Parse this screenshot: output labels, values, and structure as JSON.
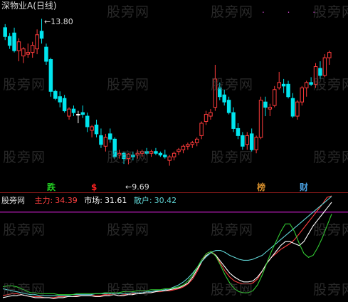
{
  "colors": {
    "background": "#000000",
    "up_candle": "#ff3b3b",
    "down_candle": "#00e5ee",
    "doji": "#ffffff",
    "label_white": "#dddddd",
    "main_force": "#ff4040",
    "market": "#ffffff",
    "retail": "#5fd3d3",
    "purple_line": "#d020d0",
    "separator": "#8b1a1a",
    "green_line": "#33cc33",
    "signal_die": "#22cc22",
    "signal_dollar": "#ff2222",
    "signal_bang": "#d08a2a",
    "signal_cai": "#4aa0e0",
    "watermark": "#4a4a4a"
  },
  "header": {
    "title": "深物业A(日线)",
    "high_label": "13.80",
    "low_label": "9.69"
  },
  "signals": {
    "die": "跌",
    "dollar": "$",
    "bang": "榜",
    "cai": "财"
  },
  "indicator": {
    "name": "股旁网",
    "main_label": "主力:",
    "main_value": "34.39",
    "market_label": "市场:",
    "market_value": "31.61",
    "retail_label": "散户:",
    "retail_value": "30.42"
  },
  "watermark_text": "股旁网",
  "top_marks": ".   .  .",
  "chart_data": [
    {
      "type": "candlestick",
      "title": "深物业A(日线)",
      "annotations": [
        {
          "text": "13.80",
          "value": 13.8
        },
        {
          "text": "9.69",
          "value": 9.69
        }
      ],
      "ylim": [
        9.3,
        14.05
      ],
      "candles": [
        [
          13.55,
          13.65,
          13.2,
          13.3
        ],
        [
          13.3,
          13.4,
          12.95,
          13.05
        ],
        [
          13.4,
          13.55,
          12.85,
          12.9
        ],
        [
          12.9,
          13.25,
          12.6,
          13.15
        ],
        [
          12.75,
          13.0,
          12.55,
          12.95
        ],
        [
          12.8,
          13.1,
          12.7,
          12.85
        ],
        [
          12.85,
          13.15,
          12.7,
          13.05
        ],
        [
          12.95,
          13.5,
          12.8,
          13.35
        ],
        [
          13.45,
          13.8,
          13.1,
          13.25
        ],
        [
          13.0,
          13.1,
          12.5,
          12.6
        ],
        [
          12.65,
          12.7,
          11.6,
          11.75
        ],
        [
          11.75,
          11.8,
          11.5,
          11.55
        ],
        [
          11.6,
          11.75,
          11.3,
          11.45
        ],
        [
          11.55,
          11.65,
          11.15,
          11.2
        ],
        [
          11.05,
          11.3,
          10.95,
          11.25
        ],
        [
          11.25,
          11.35,
          11.05,
          11.15
        ],
        [
          11.1,
          11.2,
          10.85,
          11.1
        ],
        [
          11.15,
          11.35,
          11.0,
          11.1
        ],
        [
          11.05,
          11.15,
          10.6,
          10.75
        ],
        [
          10.65,
          10.8,
          10.45,
          10.75
        ],
        [
          10.8,
          10.95,
          10.45,
          10.55
        ],
        [
          10.5,
          10.7,
          10.15,
          10.25
        ],
        [
          10.2,
          10.55,
          10.05,
          10.45
        ],
        [
          10.55,
          10.7,
          10.3,
          10.4
        ],
        [
          10.4,
          10.45,
          9.85,
          9.9
        ],
        [
          9.95,
          10.1,
          9.85,
          10.0
        ],
        [
          10.0,
          10.05,
          9.7,
          9.85
        ],
        [
          9.85,
          10.0,
          9.69,
          9.98
        ],
        [
          9.95,
          10.05,
          9.8,
          9.9
        ],
        [
          9.95,
          10.1,
          9.85,
          10.0
        ],
        [
          10.0,
          10.1,
          9.9,
          10.05
        ],
        [
          10.05,
          10.15,
          9.95,
          10.0
        ],
        [
          10.0,
          10.1,
          9.9,
          10.05
        ],
        [
          10.05,
          10.15,
          9.95,
          10.0
        ],
        [
          10.0,
          10.05,
          9.9,
          9.95
        ],
        [
          9.95,
          10.1,
          9.85,
          9.9
        ],
        [
          9.8,
          9.95,
          9.65,
          9.9
        ],
        [
          9.9,
          10.05,
          9.8,
          10.0
        ],
        [
          10.05,
          10.15,
          9.95,
          10.1
        ],
        [
          10.1,
          10.25,
          10.0,
          10.2
        ],
        [
          10.2,
          10.3,
          10.1,
          10.25
        ],
        [
          10.25,
          10.35,
          10.15,
          10.3
        ],
        [
          10.3,
          10.45,
          10.2,
          10.4
        ],
        [
          10.5,
          10.9,
          10.4,
          10.85
        ],
        [
          10.9,
          11.2,
          10.8,
          11.1
        ],
        [
          11.05,
          11.25,
          10.95,
          11.15
        ],
        [
          11.3,
          12.5,
          11.2,
          12.1
        ],
        [
          11.85,
          12.0,
          11.5,
          11.6
        ],
        [
          11.65,
          11.8,
          11.35,
          11.45
        ],
        [
          11.5,
          11.6,
          11.1,
          11.15
        ],
        [
          11.15,
          11.3,
          10.6,
          10.7
        ],
        [
          10.7,
          10.85,
          10.4,
          10.5
        ],
        [
          10.5,
          10.6,
          10.1,
          10.2
        ],
        [
          10.25,
          10.6,
          10.1,
          10.5
        ],
        [
          10.55,
          10.7,
          10.05,
          10.1
        ],
        [
          10.1,
          10.5,
          10.0,
          10.45
        ],
        [
          10.45,
          11.6,
          10.4,
          11.5
        ],
        [
          11.45,
          11.6,
          11.05,
          11.3
        ],
        [
          11.25,
          11.4,
          11.05,
          11.3
        ],
        [
          11.35,
          11.9,
          11.3,
          11.8
        ],
        [
          11.85,
          12.3,
          11.8,
          12.0
        ],
        [
          11.95,
          12.1,
          11.7,
          11.9
        ],
        [
          11.95,
          12.05,
          11.55,
          11.6
        ],
        [
          11.55,
          11.7,
          11.0,
          11.05
        ],
        [
          11.05,
          11.5,
          10.95,
          11.45
        ],
        [
          11.45,
          11.9,
          11.35,
          11.85
        ],
        [
          11.85,
          12.05,
          11.6,
          12.0
        ],
        [
          12.0,
          12.15,
          11.9,
          11.95
        ],
        [
          11.95,
          12.55,
          11.85,
          12.45
        ],
        [
          12.4,
          12.6,
          12.1,
          12.2
        ],
        [
          12.2,
          12.8,
          12.15,
          12.7
        ],
        [
          12.7,
          12.9,
          12.5,
          12.85
        ]
      ]
    },
    {
      "type": "line",
      "title": "股旁网",
      "ylim": [
        0,
        100
      ],
      "reference_line": 90,
      "series": [
        {
          "name": "主力",
          "color": "#ff4040",
          "values": [
            5,
            6,
            7,
            7,
            6,
            5,
            4,
            4,
            4,
            3,
            3,
            3,
            4,
            4,
            4,
            4,
            5,
            5,
            5,
            5,
            5,
            5,
            6,
            6,
            6,
            5,
            6,
            6,
            7,
            7,
            8,
            8,
            8,
            9,
            9,
            10,
            10,
            11,
            12,
            14,
            17,
            22,
            30,
            40,
            48,
            50,
            46,
            38,
            30,
            24,
            20,
            18,
            17,
            17,
            18,
            22,
            30,
            38,
            44,
            48,
            52,
            55,
            58,
            62,
            68,
            74,
            80,
            86,
            92,
            98,
            105,
            110
          ]
        },
        {
          "name": "市场",
          "color": "#ffffff",
          "values": [
            3,
            4,
            5,
            5,
            6,
            5,
            4,
            3,
            3,
            3,
            3,
            2,
            3,
            3,
            4,
            4,
            4,
            5,
            5,
            5,
            4,
            4,
            5,
            5,
            6,
            5,
            5,
            6,
            6,
            7,
            7,
            8,
            8,
            9,
            10,
            10,
            11,
            12,
            13,
            15,
            18,
            24,
            32,
            40,
            46,
            49,
            46,
            40,
            34,
            28,
            24,
            21,
            19,
            19,
            20,
            24,
            30,
            38,
            44,
            50,
            56,
            60,
            60,
            58,
            56,
            60,
            68,
            76,
            82,
            88,
            94,
            100
          ]
        },
        {
          "name": "散户",
          "color": "#5fd3d3",
          "values": [
            12,
            11,
            10,
            9,
            8,
            7,
            6,
            6,
            5,
            5,
            5,
            5,
            5,
            5,
            5,
            6,
            6,
            6,
            6,
            6,
            7,
            7,
            7,
            7,
            7,
            7,
            7,
            7,
            8,
            8,
            8,
            9,
            9,
            10,
            10,
            11,
            12,
            14,
            16,
            19,
            23,
            28,
            34,
            40,
            45,
            49,
            51,
            51,
            49,
            46,
            44,
            42,
            41,
            41,
            42,
            44,
            46,
            50,
            54,
            58,
            62,
            66,
            70,
            74,
            78,
            82,
            86,
            90,
            94,
            98,
            102,
            106
          ]
        },
        {
          "name": "",
          "color": "#33cc33",
          "values": [
            14,
            15,
            15,
            14,
            12,
            10,
            8,
            8,
            7,
            7,
            7,
            7,
            6,
            6,
            6,
            6,
            7,
            7,
            7,
            7,
            7,
            7,
            8,
            8,
            8,
            8,
            9,
            9,
            9,
            10,
            10,
            10,
            11,
            11,
            11,
            12,
            12,
            13,
            14,
            16,
            20,
            26,
            34,
            42,
            48,
            50,
            45,
            36,
            26,
            18,
            12,
            9,
            8,
            8,
            10,
            16,
            26,
            38,
            50,
            60,
            70,
            78,
            78,
            70,
            58,
            48,
            44,
            46,
            54,
            64,
            76,
            88
          ]
        }
      ]
    }
  ]
}
